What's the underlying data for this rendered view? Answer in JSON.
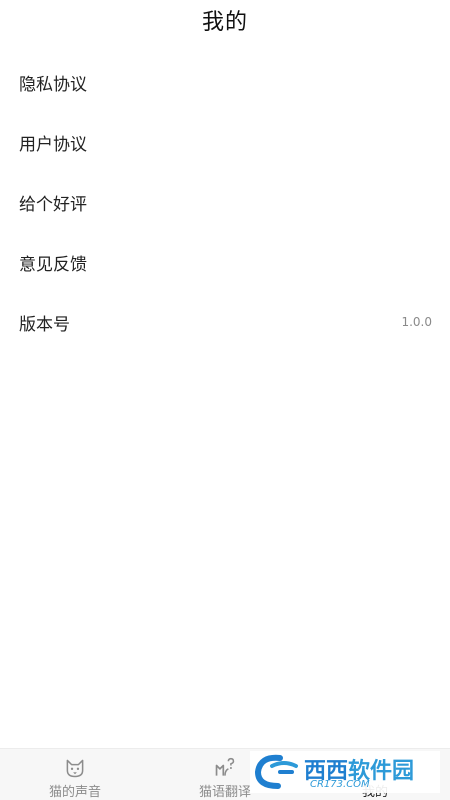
{
  "header": {
    "title": "我的"
  },
  "menu": {
    "items": [
      {
        "label": "隐私协议",
        "value": ""
      },
      {
        "label": "用户协议",
        "value": ""
      },
      {
        "label": "给个好评",
        "value": ""
      },
      {
        "label": "意见反馈",
        "value": ""
      },
      {
        "label": "版本号",
        "value": "1.0.0"
      }
    ]
  },
  "tabbar": {
    "active_index": 2,
    "tabs": [
      {
        "label": "猫的声音",
        "icon": "cat-face-icon"
      },
      {
        "label": "猫语翻译",
        "icon": "cat-translate-icon"
      },
      {
        "label": "我的",
        "icon": ""
      }
    ]
  },
  "watermark": {
    "main_a": "西西",
    "main_b": "软件园",
    "sub": "CR173.COM"
  },
  "colors": {
    "background": "#ffffff",
    "text": "#222222",
    "muted": "#8a8a8a",
    "tabbar_bg": "#f7f7f7",
    "watermark_blue": "#1f7fd0"
  }
}
